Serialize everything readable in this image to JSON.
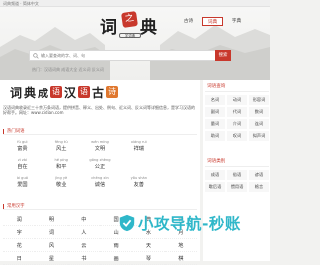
{
  "topbar": {
    "crumb": "词典频道 · 简体中文"
  },
  "logo": {
    "char_left": "词",
    "char_right": "典",
    "seal": "之",
    "subtitle": "字词典"
  },
  "nav": {
    "tabs": [
      {
        "label": "古诗"
      },
      {
        "label": "词典"
      },
      {
        "label": "字典"
      }
    ],
    "active_index": 1
  },
  "search": {
    "placeholder": "输入要查询的字、词、句",
    "button": "搜索"
  },
  "hotnote": "热门：汉语词典 成语大全 近义词 反义词",
  "banner": {
    "parts": [
      {
        "t": "词",
        "kind": "ch"
      },
      {
        "t": "典",
        "kind": "ch"
      },
      {
        "t": "成",
        "kind": "chsm"
      },
      {
        "t": "语",
        "kind": "seal"
      },
      {
        "t": "汉",
        "kind": "ch"
      },
      {
        "t": "语",
        "kind": "seal"
      },
      {
        "t": "古",
        "kind": "ch"
      },
      {
        "t": "诗",
        "kind": "sealorange"
      }
    ]
  },
  "intro": "汉语词典收录近三十余万条词语，提供拼音、释义、出处、例句、近义词、反义词等详细信息，是学习汉语的好帮手。网址：www.cidian.com",
  "sections": {
    "words": "热门词语",
    "chars": "常用汉字"
  },
  "words": [
    {
      "py": "fù guì",
      "w": "富贵"
    },
    {
      "py": "fēng tǔ",
      "w": "风土"
    },
    {
      "py": "wén míng",
      "w": "文明"
    },
    {
      "py": "xiáng ruì",
      "w": "祥瑞"
    },
    {
      "py": "",
      "w": ""
    },
    {
      "py": "zì zài",
      "w": "自在"
    },
    {
      "py": "hé píng",
      "w": "和平"
    },
    {
      "py": "gōng zhèng",
      "w": "公正"
    },
    {
      "py": "",
      "w": ""
    },
    {
      "py": "",
      "w": ""
    },
    {
      "py": "ài guó",
      "w": "爱国"
    },
    {
      "py": "jìng yè",
      "w": "敬业"
    },
    {
      "py": "chéng xìn",
      "w": "诚信"
    },
    {
      "py": "yǒu shàn",
      "w": "友善"
    },
    {
      "py": "",
      "w": ""
    }
  ],
  "chars": [
    "润",
    "明",
    "中",
    "国",
    "典",
    "诗",
    "字",
    "词",
    "人",
    "山",
    "水",
    "月",
    "花",
    "风",
    "云",
    "雨",
    "天",
    "地",
    "日",
    "星",
    "书",
    "画",
    "琴",
    "棋"
  ],
  "side": {
    "panel1": {
      "title": "词语查询",
      "items": [
        "名词",
        "动词",
        "形容词",
        "副词",
        "代词",
        "数词",
        "量词",
        "介词",
        "连词",
        "助词",
        "叹词",
        "拟声词"
      ]
    },
    "panel2": {
      "title": "词语类别",
      "items": [
        "成语",
        "俗语",
        "谚语",
        "歇后语",
        "惯用语",
        "格言"
      ]
    }
  },
  "watermark": {
    "text": "小攻导航-秒账",
    "icon": "shield-check-icon"
  },
  "colors": {
    "accent": "#c8382c",
    "orange": "#e0782f",
    "watermark": "#2fb7c9"
  }
}
